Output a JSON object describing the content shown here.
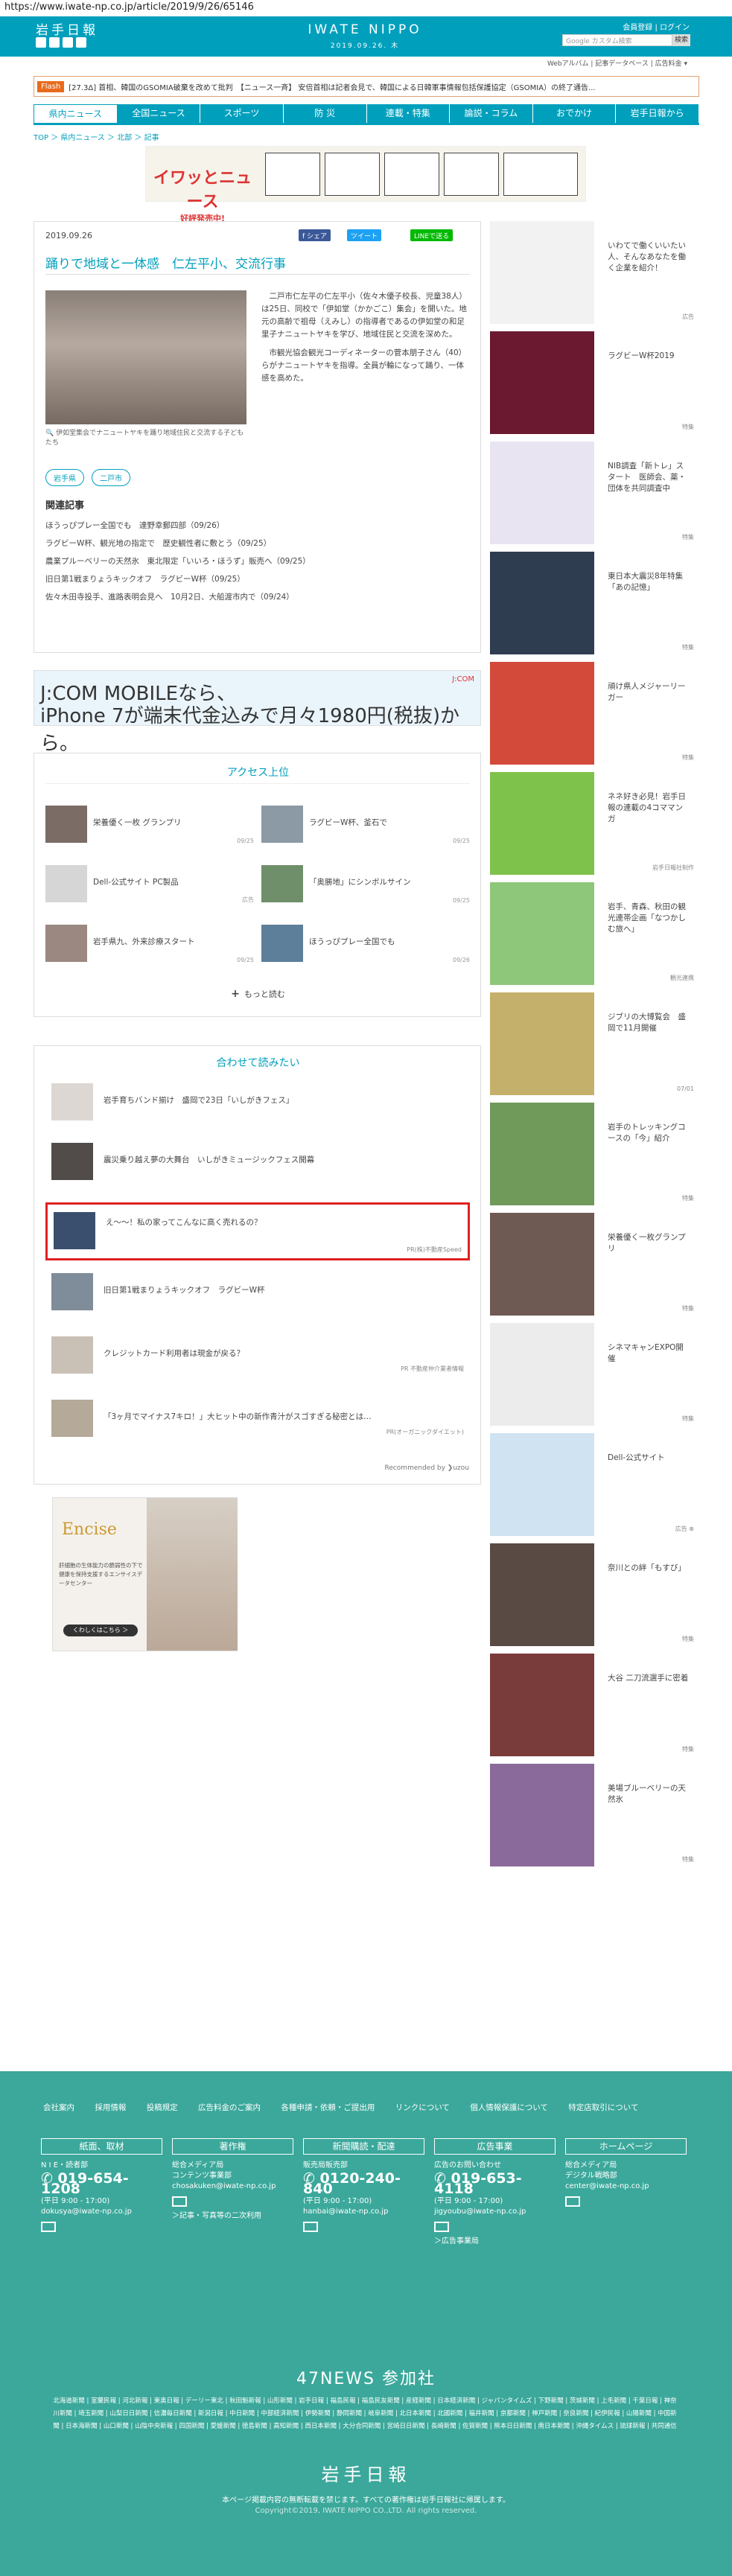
{
  "url": "https://www.iwate-np.co.jp/article/2019/9/26/65146",
  "header": {
    "logo": "岩手日報",
    "brand": "IWATE NIPPO",
    "date": "2019.09.26. 木",
    "links": "会員登録 | ログイン",
    "search_placeholder": "Google カスタム検索",
    "search_button": "検索",
    "subnav": "Webアルバム | 記事データベース | 広告料金 ▾"
  },
  "ticker": {
    "badge": "Flash",
    "text": "[27.3Δ] 首相、韓国のGSOMIA破棄を改めて批判　【ニュース一斉】 安倍首相は記者会見で、韓国による日韓軍事情報包括保護協定（GSOMIA）の終了通告..."
  },
  "nav": [
    "県内ニュース",
    "全国ニュース",
    "スポーツ",
    "防 災",
    "連載・特集",
    "論説・コラム",
    "おでかけ",
    "岩手日報から"
  ],
  "breadcrumb": "TOP ＞ 県内ニュース ＞ 北部 ＞ 記事",
  "ad_banner1": {
    "title": "イワッとニュース",
    "sub": "好評発売中!"
  },
  "article": {
    "date": "2019.09.26",
    "share_fb": "f シェア",
    "share_tw": "ツイート",
    "share_line": "LINEで送る",
    "title": "踊りで地域と一体感　仁左平小、交流行事",
    "caption": "伊如堂集会でナニュートヤキを踊り地域住民と交流する子どもたち",
    "body1": "二戸市仁左平の仁左平小（佐々木優子校長、児童38人）は25日、同校で「伊如堂（かかごこ）集会」を開いた。地元の高齢で祖母（えみし）の指導者であるの伊如堂の和足里子ナニュートヤキを学び、地域住民と交流を深めた。",
    "body2": "市観光協会観光コーディネーターの菅本朋子さん（40）らがナニュートヤキを指導。全員が輪になって踊り、一体感を高めた。",
    "tags": [
      "岩手県",
      "二戸市"
    ],
    "related_heading": "関連記事",
    "related": [
      "ほうっぴプレー全国でも　達野幸郵四部（09/26）",
      "ラグビーW杯、観光地の指定で　歴史観性者に敷とう（09/25）",
      "農業プルーベリーの天然氷　東北限定「いいろ・ほうず」販売へ（09/25）",
      "旧日第1戦まりょうキックオフ　ラグビーW杯（09/25）",
      "佐々木田寺投手、進路表明会見へ　10月2日、大船渡市内で（09/24）"
    ]
  },
  "ad_jcom": {
    "line1": "J:COM MOBILEなら、",
    "line2": "iPhone 7が端末代金込みで月々1980円(税抜)から。",
    "logo": "J:COM"
  },
  "access": {
    "heading": "アクセス上位",
    "items": [
      {
        "title": "栄養優く一枚 グランプリ",
        "date": "09/25"
      },
      {
        "title": "ラグビーW杯、釜石で",
        "date": "09/25"
      },
      {
        "title": "Dell-公式サイト PC製品",
        "date": "広告"
      },
      {
        "title": "「奥勝地」にシンボルサイン",
        "date": "09/25"
      },
      {
        "title": "岩手県九、外来診療スタート",
        "date": "09/25"
      },
      {
        "title": "ほうっぴプレー全国でも",
        "date": "09/26"
      }
    ],
    "more": "もっと読む"
  },
  "together": {
    "heading": "合わせて読みたい",
    "items": [
      {
        "title": "岩手育ちバンド揃け　盛岡で23日「いしがきフェス」",
        "pr": ""
      },
      {
        "title": "震災乗り越え夢の大舞台　いしがきミュージックフェス開幕",
        "pr": ""
      },
      {
        "title": "え〜〜！私の家ってこんなに高く売れるの？",
        "pr": "PR(株)不動産Speed"
      },
      {
        "title": "旧日第1戦まりょうキックオフ　ラグビーW杯",
        "pr": ""
      },
      {
        "title": "クレジットカード利用者は現金が戻る？",
        "pr": "PR 不動産仲介業者情報"
      },
      {
        "title": "「3ヶ月でマイナス7キロ！」大ヒット中の新作青汁がスゴすぎる秘密とは…",
        "pr": "PR(オーガニックダイエット)"
      }
    ],
    "powered": "Recommended by ❯uzou"
  },
  "ad_encise": {
    "brand": "Encise",
    "desc": "肝細胞の生体能力の脆弱性の下で健康を保持支援するエンサイスデータセンター",
    "button": "くわしくはこちら ＞"
  },
  "sidebar": [
    {
      "title": "いわてで働くいいたい人、そんなあなたを働く企業を紹介！",
      "tag": "広告"
    },
    {
      "title": "ラグビーW杯2019",
      "tag": "特集"
    },
    {
      "title": "NIB調査「新トレ」スタート　医師会、薬・団体を共同調査中",
      "tag": "特集"
    },
    {
      "title": "東日本大震災8年特集「あの記憶」",
      "tag": "特集"
    },
    {
      "title": "頑け県人メジャーリーガー",
      "tag": "特集"
    },
    {
      "title": "ネネ好き必見！岩手日報の連載の4コママンガ",
      "tag": "岩手日報社制作"
    },
    {
      "title": "岩手、青森、秋田の観光連帯企画「なつかしむ旅へ」",
      "tag": "観光連携"
    },
    {
      "title": "ジブリの大博覧会　盛岡で11月開催",
      "tag": "07/01"
    },
    {
      "title": "岩手のトレッキングコースの「今」紹介",
      "tag": "特集"
    },
    {
      "title": "栄養優く一枚グランプリ",
      "tag": "特集"
    },
    {
      "title": "シネマキャンEXPO開催",
      "tag": "特集"
    },
    {
      "title": "Dell-公式サイト",
      "tag": "広告 ⊗"
    },
    {
      "title": "奈川との絆「もすび」",
      "tag": "特集"
    },
    {
      "title": "大谷 二刀流選手に密着",
      "tag": "特集"
    },
    {
      "title": "美場ブルーベリーの天然氷",
      "tag": "特集"
    }
  ],
  "footer": {
    "links": [
      "会社案内",
      "採用情報",
      "投稿規定",
      "広告料金のご案内",
      "各種申請・依頼・ご提出用",
      "リンクについて",
      "個人情報保護について",
      "特定店取引について"
    ],
    "cols": [
      {
        "head": "紙面、取材",
        "l1": "N I E・読者部",
        "phone": "019-654-1208",
        "hours": "(平日 9:00 - 17:00)",
        "mail": "dokusya@iwate-np.co.jp",
        "extra": ""
      },
      {
        "head": "著作権",
        "l1": "総合メディア局",
        "phone": "",
        "hours": "コンテンツ事業部",
        "mail": "chosakuken@iwate-np.co.jp",
        "extra": "＞記事・写真等の二次利用"
      },
      {
        "head": "新聞購読・配達",
        "l1": "販売局販売部",
        "phone": "0120-240-840",
        "hours": "(平日 9:00 - 17:00)",
        "mail": "hanbai@iwate-np.co.jp",
        "extra": ""
      },
      {
        "head": "広告事業",
        "l1": "広告のお問い合わせ",
        "phone": "019-653-4118",
        "hours": "(平日 9:00 - 17:00)",
        "mail": "jigyoubu@iwate-np.co.jp",
        "extra": "＞広告事業局"
      },
      {
        "head": "ホームページ",
        "l1": "総合メディア局",
        "phone": "",
        "hours": "デジタル戦略部",
        "mail": "center@iwate-np.co.jp",
        "extra": ""
      }
    ],
    "news47": "47NEWS 参加社",
    "papers": "北海道新聞 | 室蘭民報 | 河北新報 | 東奥日報 | デーリー東北 | 秋田魁新報 | 山形新聞 | 岩手日報 | 福島民報 | 福島民友新聞 | 産経新聞 | 日本経済新聞 | ジャパンタイムズ | 下野新聞 | 茨城新聞 | 上毛新聞 | 千葉日報 | 神奈川新聞 | 埼玉新聞 | 山梨日日新聞 | 信濃毎日新聞 | 新潟日報 | 中日新聞 | 中部経済新聞 | 伊勢新聞 | 静岡新聞 | 岐阜新聞 | 北日本新聞 | 北國新聞 | 福井新聞 | 京都新聞 | 神戸新聞 | 奈良新聞 | 紀伊民報 | 山陽新聞 | 中国新聞 | 日本海新聞 | 山口新聞 | 山陰中央新報 | 四国新聞 | 愛媛新聞 | 徳島新聞 | 高知新聞 | 西日本新聞 | 大分合同新聞 | 宮崎日日新聞 | 長崎新聞 | 佐賀新聞 | 熊本日日新聞 | 南日本新聞 | 沖縄タイムス | 琉球新報 | 共同通信",
    "logo": "岩手日報",
    "copy1": "本ページ掲載内容の無断転載を禁じます。すべての著作権は岩手日報社に帰属します。",
    "copy2": "Copyright©2019, IWATE NIPPO CO.,LTD. All rights reserved."
  }
}
